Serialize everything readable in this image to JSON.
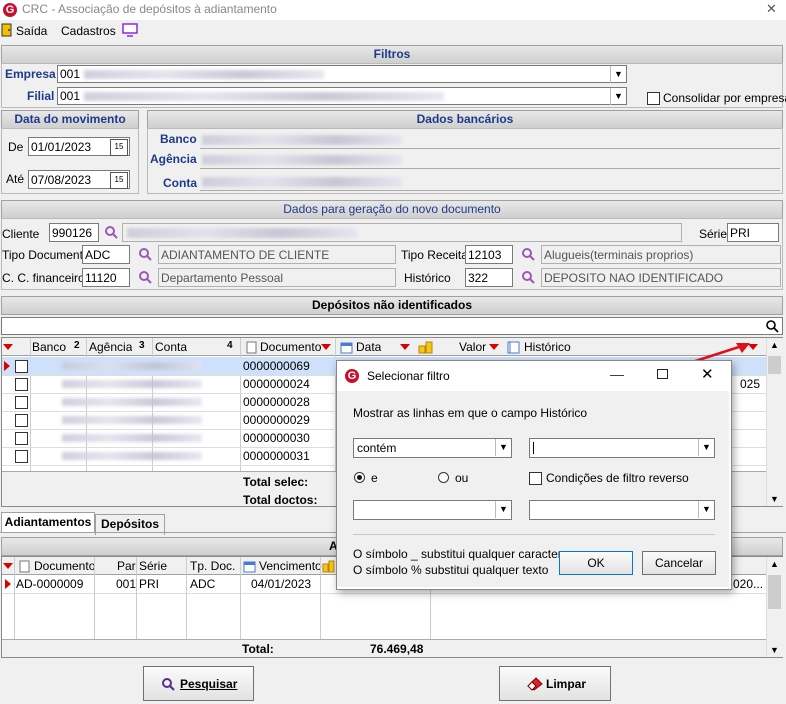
{
  "window": {
    "title": "CRC - Associação de depósitos à adiantamento",
    "close": "✕"
  },
  "menu": {
    "exit": "Saída",
    "records": "Cadastros"
  },
  "filtros": {
    "header": "Filtros",
    "empresa_label": "Empresa",
    "empresa_code": "001",
    "filial_label": "Filial",
    "filial_code": "001",
    "consolidar": "Consolidar por empresa"
  },
  "data_mov": {
    "header": "Data do movimento",
    "de_label": "De",
    "de_value": "01/01/2023",
    "ate_label": "Até",
    "ate_value": "07/08/2023",
    "cal": "15"
  },
  "bancarios": {
    "header": "Dados bancários",
    "banco": "Banco",
    "agencia": "Agência",
    "conta": "Conta"
  },
  "novo_doc": {
    "header": "Dados para geração do novo documento",
    "cliente_label": "Cliente",
    "cliente_code": "990126",
    "serie_label": "Série",
    "serie_value": "PRI",
    "tipo_doc_label": "Tipo Documento",
    "tipo_doc_code": "ADC",
    "tipo_doc_desc": "ADIANTAMENTO DE CLIENTE",
    "tipo_receita_label": "Tipo Receita",
    "tipo_receita_code": "12103",
    "tipo_receita_desc": "Alugueis(terminais proprios)",
    "cc_label": "C. C. financeiro",
    "cc_code": "11120",
    "cc_desc": "Departamento Pessoal",
    "historico_label": "Histórico",
    "historico_code": "322",
    "historico_desc": "DEPOSITO NAO IDENTIFICADO"
  },
  "depositos": {
    "header": "Depósitos não identificados",
    "columns": {
      "banco": "Banco",
      "banco_n": "2",
      "agencia": "Agência",
      "agencia_n": "3",
      "conta": "Conta",
      "conta_n": "4",
      "documento": "Documento",
      "data": "Data",
      "valor": "Valor",
      "historico": "Histórico"
    },
    "rows": [
      {
        "doc": "0000000069"
      },
      {
        "doc": "0000000024"
      },
      {
        "doc": "0000000028"
      },
      {
        "doc": "0000000029"
      },
      {
        "doc": "0000000030"
      },
      {
        "doc": "0000000031"
      }
    ],
    "hidden_partial": "025",
    "total_selec": "Total selec:",
    "total_doctos": "Total doctos:"
  },
  "tabs": {
    "adiantamentos": "Adiantamentos",
    "depositos": "Depósitos"
  },
  "adiant": {
    "header_partial": "A",
    "columns": {
      "documento": "Documento",
      "par": "Par",
      "serie": "Série",
      "tp_doc": "Tp. Doc.",
      "vencimento": "Vencimento"
    },
    "row": {
      "documento": "AD-0000009",
      "par": "001",
      "serie": "PRI",
      "tp_doc": "ADC",
      "vencimento": "04/01/2023",
      "tail": "020..."
    },
    "total_label": "Total:",
    "total_value": "76.469,48"
  },
  "buttons": {
    "pesquisar": "Pesquisar",
    "limpar": "Limpar"
  },
  "dialog": {
    "title": "Selecionar filtro",
    "prompt": "Mostrar as linhas em que o campo Histórico",
    "op1": "contém",
    "and": "e",
    "or": "ou",
    "reverse": "Condições de filtro reverso",
    "hint1": "O símbolo _ substitui qualquer caractere",
    "hint2": "O símbolo % substitui qualquer texto",
    "ok": "OK",
    "cancel": "Cancelar"
  }
}
